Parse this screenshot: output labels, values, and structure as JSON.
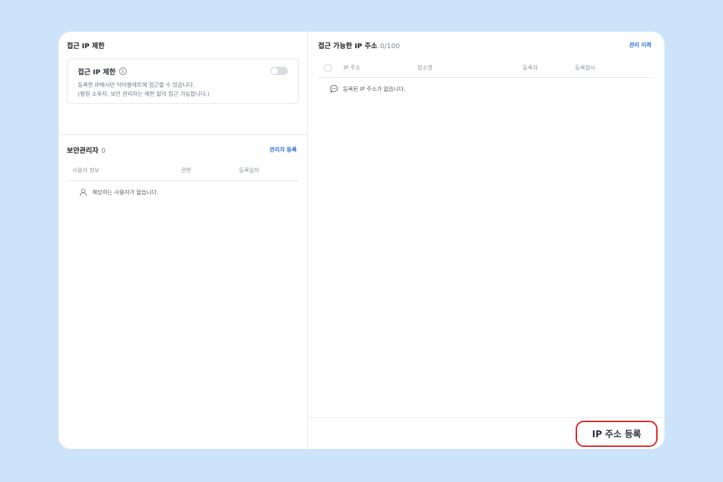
{
  "ip_restriction": {
    "title": "접근 IP 제한",
    "box_title": "접근 IP 제한",
    "info_icon": "info-icon",
    "toggle_state": "off",
    "desc_line1": "등록한 IP에서만 닥터팔레트에 접근할 수 있습니다.",
    "desc_line2": "(병원 소유자, 보안 관리자는 제한 없이 접근 가능합니다.)"
  },
  "security_admin": {
    "title": "보안관리자",
    "count": "0",
    "register_link": "관리자 등록",
    "columns": [
      "사용자 정보",
      "권한",
      "등록일자"
    ],
    "empty_text": "해당하는 사용자가 없습니다."
  },
  "allowed_ips": {
    "title": "접근 가능한 IP 주소",
    "count": "0/100",
    "history_link": "관리 이력",
    "columns": [
      "IP 주소",
      "장소명",
      "등록자",
      "등록일시"
    ],
    "empty_text": "등록된 IP 주소가 없습니다.",
    "register_button": "IP 주소 등록"
  },
  "colors": {
    "background": "#cde3fa",
    "link": "#2f6fde",
    "highlight": "#e01e1e"
  }
}
